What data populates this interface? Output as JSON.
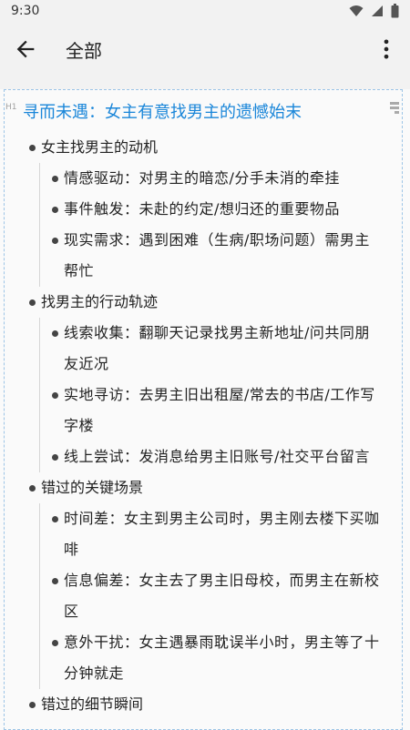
{
  "status": {
    "time": "9:30"
  },
  "appbar": {
    "title": "全部"
  },
  "doc": {
    "tag": "H1",
    "heading": "寻而未遇：女主有意找男主的遗憾始末",
    "sections": [
      {
        "title": "女主找男主的动机",
        "items": [
          "情感驱动：对男主的暗恋/分手未消的牵挂",
          "事件触发：未赴的约定/想归还的重要物品",
          "现实需求：遇到困难（生病/职场问题）需男主帮忙"
        ]
      },
      {
        "title": "找男主的行动轨迹",
        "items": [
          "线索收集：翻聊天记录找男主新地址/问共同朋友近况",
          "实地寻访：去男主旧出租屋/常去的书店/工作写字楼",
          "线上尝试：发消息给男主旧账号/社交平台留言"
        ]
      },
      {
        "title": "错过的关键场景",
        "items": [
          "时间差：女主到男主公司时，男主刚去楼下买咖啡",
          "信息偏差：女主去了男主旧母校，而男主在新校区",
          "意外干扰：女主遇暴雨耽误半小时，男主等了十分钟就走"
        ]
      },
      {
        "title": "错过的细节瞬间",
        "items": []
      }
    ]
  }
}
